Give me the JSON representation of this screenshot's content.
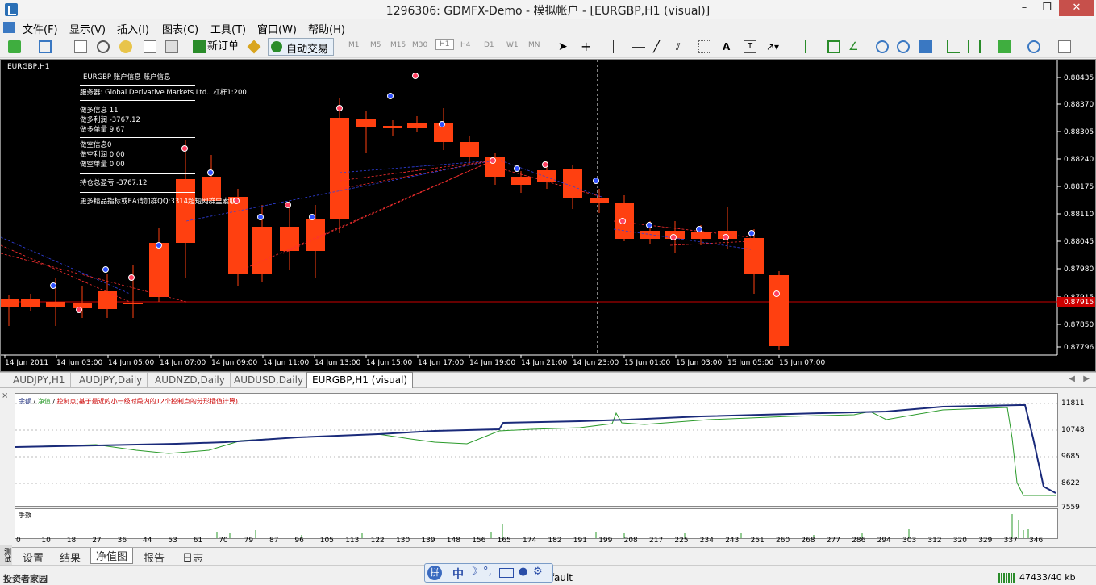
{
  "window": {
    "title": "1296306: GDMFX-Demo - 模拟帐户 - [EURGBP,H1 (visual)]",
    "min": "–",
    "restore": "❐",
    "close": "✕"
  },
  "menu": [
    "文件(F)",
    "显示(V)",
    "插入(I)",
    "图表(C)",
    "工具(T)",
    "窗口(W)",
    "帮助(H)"
  ],
  "toolbar": {
    "new_order": "新订单",
    "auto_trade": "自动交易",
    "timeframes": [
      "M1",
      "M5",
      "M15",
      "M30",
      "H1",
      "H4",
      "D1",
      "W1",
      "MN"
    ]
  },
  "chart": {
    "symbol_label": "EURGBP,H1",
    "info": {
      "header": "EURGBP    账户信息  账户信息",
      "server": "服务器: Global Derivative Markets Ltd.. 杠杆1:200",
      "long_count": "做多信息 11",
      "long_profit": "做多利润 -3767.12",
      "long_lots": "做多单量 9.67",
      "short_count": "做空信息0",
      "short_profit": "做空利润 0.00",
      "short_lots": "做空单量 0.00",
      "total": "持仓总盈亏 -3767.12",
      "promo": "更多精品指标或EA请加群QQ:3314超短网群里索取"
    },
    "price_ticks": [
      "0.88435",
      "0.88370",
      "0.88305",
      "0.88240",
      "0.88175",
      "0.88110",
      "0.88045",
      "0.87980",
      "0.87915",
      "0.87850",
      "0.87796"
    ],
    "current_price": "0.87915",
    "time_ticks": [
      "14 Jun 2011",
      "14 Jun 03:00",
      "14 Jun 05:00",
      "14 Jun 07:00",
      "14 Jun 09:00",
      "14 Jun 11:00",
      "14 Jun 13:00",
      "14 Jun 15:00",
      "14 Jun 17:00",
      "14 Jun 19:00",
      "14 Jun 21:00",
      "14 Jun 23:00",
      "15 Jun 01:00",
      "15 Jun 03:00",
      "15 Jun 05:00",
      "15 Jun 07:00"
    ],
    "colors": {
      "bull": "#22ee22",
      "bear": "#ff4010",
      "bg": "#000000",
      "price_line": "#cc0000"
    }
  },
  "chart_tabs": [
    "AUDJPY,H1",
    "AUDJPY,Daily",
    "AUDNZD,Daily",
    "AUDUSD,Daily",
    "EURGBP,H1 (visual)"
  ],
  "equity": {
    "legend": {
      "balance": "余额",
      "sep": " / ",
      "equity": "净值",
      "sep2": " / ",
      "control": "控制点(基于最近的小一级时段内的12个控制点的分形插值计算)"
    },
    "y_ticks": [
      "11811",
      "10748",
      "9685",
      "8622",
      "7559"
    ],
    "lots_label": "手数",
    "x_ticks": [
      "0",
      "10",
      "18",
      "27",
      "36",
      "44",
      "53",
      "61",
      "70",
      "79",
      "87",
      "96",
      "105",
      "113",
      "122",
      "130",
      "139",
      "148",
      "156",
      "165",
      "174",
      "182",
      "191",
      "199",
      "208",
      "217",
      "225",
      "234",
      "243",
      "251",
      "260",
      "268",
      "277",
      "286",
      "294",
      "303",
      "312",
      "320",
      "329",
      "337",
      "346"
    ]
  },
  "bottom_tabs": [
    "设置",
    "结果",
    "净值图",
    "报告",
    "日志"
  ],
  "side_label": "测试",
  "status": {
    "default": "Default",
    "traffic": "47433/40 kb",
    "watermark": "投资者家园"
  }
}
